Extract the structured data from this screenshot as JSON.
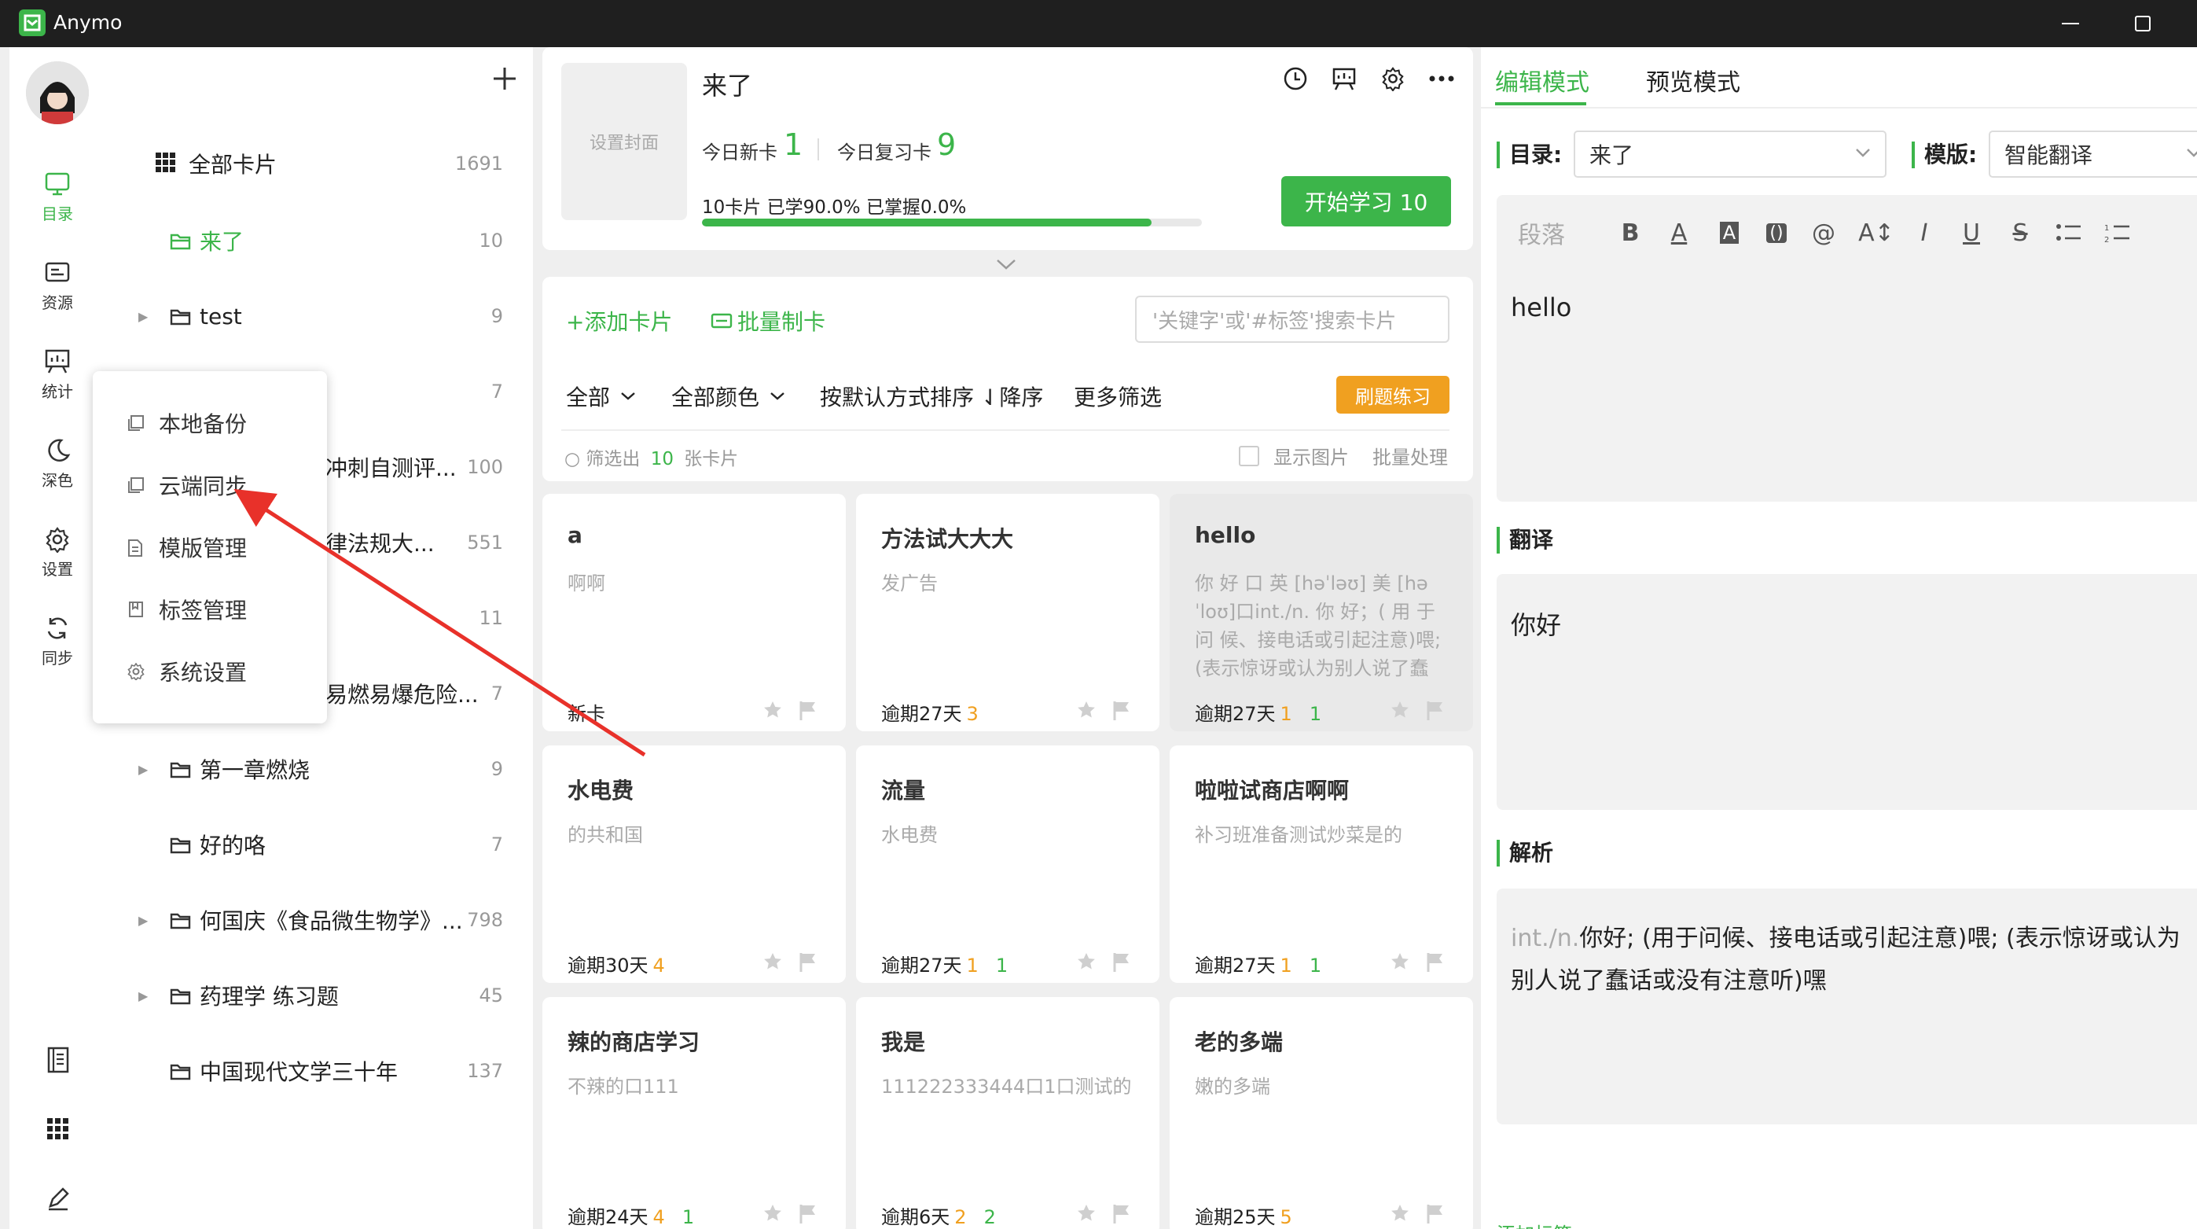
{
  "window": {
    "title": "Anymo"
  },
  "rail": {
    "items": [
      {
        "label": "目录"
      },
      {
        "label": "资源"
      },
      {
        "label": "统计"
      },
      {
        "label": "深色"
      },
      {
        "label": "设置"
      },
      {
        "label": "同步"
      }
    ]
  },
  "tree": {
    "items": [
      {
        "label": "全部卡片",
        "count": "1691"
      },
      {
        "label": "来了",
        "count": "10"
      },
      {
        "label": "test",
        "count": "9"
      },
      {
        "label": "",
        "count": "7"
      },
      {
        "label": "冲刺自测评...",
        "count": "100"
      },
      {
        "label": "律法规大...",
        "count": "551"
      },
      {
        "label": "",
        "count": "11"
      },
      {
        "label": "易燃易爆危险...",
        "count": "7"
      },
      {
        "label": "第一章燃烧",
        "count": "9"
      },
      {
        "label": "好的咯",
        "count": "7"
      },
      {
        "label": "何国庆《食品微生物学》...",
        "count": "798"
      },
      {
        "label": "药理学 练习题",
        "count": "45"
      },
      {
        "label": "中国现代文学三十年",
        "count": "137"
      }
    ]
  },
  "popup": {
    "items": [
      {
        "label": "本地备份"
      },
      {
        "label": "云端同步"
      },
      {
        "label": "模版管理"
      },
      {
        "label": "标签管理"
      },
      {
        "label": "系统设置"
      }
    ]
  },
  "deck": {
    "cover_label": "设置封面",
    "title": "来了",
    "new_label": "今日新卡",
    "new_value": "1",
    "review_label": "今日复习卡",
    "review_value": "9",
    "progress_text": "10卡片  已学90.0%  已掌握0.0%",
    "learned_fraction": 0.9,
    "start_label": "开始学习 10"
  },
  "toolbar": {
    "add_card": "+添加卡片",
    "batch_make": "批量制卡",
    "search_placeholder": "'关键字'或'#标签'搜索卡片",
    "filter_all": "全部",
    "filter_color": "全部颜色",
    "sort": "按默认方式排序 ⇃降序",
    "more_filter": "更多筛选",
    "practice": "刷题练习",
    "result_prefix": "筛选出",
    "result_count": "10",
    "result_suffix": "张卡片",
    "show_images": "显示图片",
    "batch_process": "批量处理"
  },
  "cards": [
    {
      "title": "a",
      "sub": "啊啊",
      "due": "新卡",
      "n1": "",
      "n2": "",
      "selected": false
    },
    {
      "title": "方法试大大大",
      "sub": "发广告",
      "due": "逾期27天",
      "n1": "3",
      "n2": "",
      "selected": false
    },
    {
      "title": "hello",
      "sub": "你 好 ⼝ 英 [həˈləʊ]       美 [həˈloʊ]⼝int./n. 你 好；( 用 于 问 候、接电话或引起注意)喂; (表示惊讶或认为别人说了蠢话...",
      "due": "逾期27天",
      "n1": "1",
      "n2": "1",
      "selected": true
    },
    {
      "title": "水电费",
      "sub": "的共和国",
      "due": "逾期30天",
      "n1": "4",
      "n2": "",
      "selected": false
    },
    {
      "title": "流量",
      "sub": "水电费",
      "due": "逾期27天",
      "n1": "1",
      "n2": "1",
      "selected": false
    },
    {
      "title": "啦啦试商店啊啊",
      "sub": "补习班准备测试炒菜是的",
      "due": "逾期27天",
      "n1": "1",
      "n2": "1",
      "selected": false
    },
    {
      "title": "辣的商店学习",
      "sub": "不辣的⼝111",
      "due": "逾期24天",
      "n1": "4",
      "n2": "1",
      "selected": false
    },
    {
      "title": "我是",
      "sub": "111222333444⼝1⼝测试的",
      "due": "逾期6天",
      "n1": "2",
      "n2": "2",
      "selected": false
    },
    {
      "title": "老的多端",
      "sub": "嫩的多端",
      "due": "逾期25天",
      "n1": "5",
      "n2": "",
      "selected": false
    }
  ],
  "editor": {
    "tab_edit": "编辑模式",
    "tab_preview": "预览模式",
    "dir_label": "目录:",
    "dir_value": "来了",
    "tpl_label": "模版:",
    "tpl_value": "智能翻译",
    "para_label": "段落",
    "front_text": "hello",
    "translation_label": "翻译",
    "translation_text": "你好",
    "analysis_label": "解析",
    "analysis_prefix": "int./n.",
    "analysis_line1": "你好; (用于问候、接电话或引起注意)喂; (表示惊讶或认为",
    "analysis_line2": "别人说了蠢话或没有注意听)嘿",
    "add_tag": "添加标签"
  },
  "colors": {
    "accent": "#3cb54a",
    "orange": "#f0a020",
    "annotation_arrow": "#e8312a"
  }
}
